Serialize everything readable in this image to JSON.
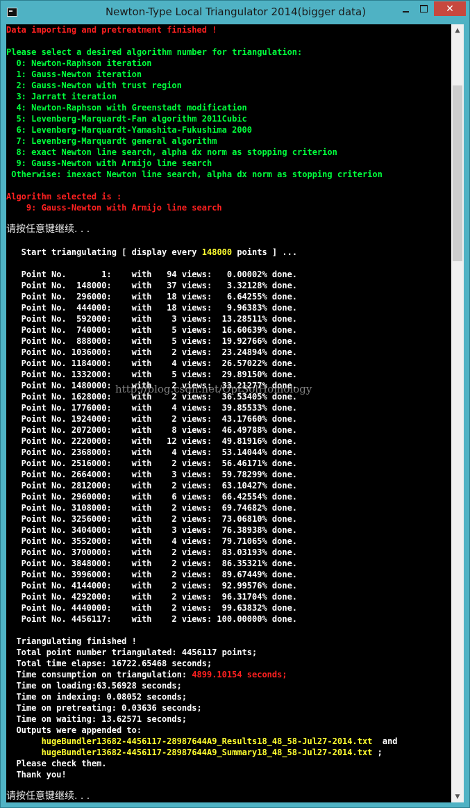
{
  "window": {
    "title": "Newton-Type Local Triangulator 2014(bigger data)",
    "minimize_label": "",
    "close_label": "✕",
    "scroll_up": "▲",
    "scroll_down": "▼"
  },
  "console": {
    "header": "Data importing and pretreatment finished !",
    "prompt": "Please select a desired algorithm number for triangulation:",
    "algorithms": [
      "  0: Newton-Raphson iteration",
      "  1: Gauss-Newton iteration",
      "  2: Gauss-Newton with trust region",
      "  3: Jarratt iteration",
      "  4: Newton-Raphson with Greenstadt modification",
      "  5: Levenberg-Marquardt-Fan algorithm 2011Cubic",
      "  6: Levenberg-Marquardt-Yamashita-Fukushima 2000",
      "  7: Levenberg-Marquardt general algorithm",
      "  8: exact Newton line search, alpha dx norm as stopping criterion",
      "  9: Gauss-Newton with Armijo line search",
      " Otherwise: inexact Newton line search, alpha dx norm as stopping criterion"
    ],
    "selected_label": "Algorithm selected is :",
    "selected_value": "    9: Gauss-Newton with Armijo line search",
    "press_key": "请按任意键继续. . .",
    "start_prefix": "   Start triangulating [ display every ",
    "start_every": "148000",
    "start_suffix": " points ] ...",
    "progress": [
      "   Point No.       1:    with   94 views:   0.00002% done.",
      "   Point No.  148000:    with   37 views:   3.32128% done.",
      "   Point No.  296000:    with   18 views:   6.64255% done.",
      "   Point No.  444000:    with   18 views:   9.96383% done.",
      "   Point No.  592000:    with    3 views:  13.28511% done.",
      "   Point No.  740000:    with    5 views:  16.60639% done.",
      "   Point No.  888000:    with    5 views:  19.92766% done.",
      "   Point No. 1036000:    with    2 views:  23.24894% done.",
      "   Point No. 1184000:    with    4 views:  26.57022% done.",
      "   Point No. 1332000:    with    5 views:  29.89150% done.",
      "   Point No. 1480000:    with    2 views:  33.21277% done.",
      "   Point No. 1628000:    with    2 views:  36.53405% done.",
      "   Point No. 1776000:    with    4 views:  39.85533% done.",
      "   Point No. 1924000:    with    2 views:  43.17660% done.",
      "   Point No. 2072000:    with    8 views:  46.49788% done.",
      "   Point No. 2220000:    with   12 views:  49.81916% done.",
      "   Point No. 2368000:    with    4 views:  53.14044% done.",
      "   Point No. 2516000:    with    2 views:  56.46171% done.",
      "   Point No. 2664000:    with    3 views:  59.78299% done.",
      "   Point No. 2812000:    with    2 views:  63.10427% done.",
      "   Point No. 2960000:    with    6 views:  66.42554% done.",
      "   Point No. 3108000:    with    2 views:  69.74682% done.",
      "   Point No. 3256000:    with    2 views:  73.06810% done.",
      "   Point No. 3404000:    with    3 views:  76.38938% done.",
      "   Point No. 3552000:    with    4 views:  79.71065% done.",
      "   Point No. 3700000:    with    2 views:  83.03193% done.",
      "   Point No. 3848000:    with    2 views:  86.35321% done.",
      "   Point No. 3996000:    with    2 views:  89.67449% done.",
      "   Point No. 4144000:    with    2 views:  92.99576% done.",
      "   Point No. 4292000:    with    2 views:  96.31704% done.",
      "   Point No. 4440000:    with    2 views:  99.63832% done.",
      "   Point No. 4456117:    with    2 views: 100.00000% done."
    ],
    "summary": {
      "finished": "  Triangulating finished !",
      "total_points": "  Total point number triangulated: 4456117 points;",
      "total_time": "  Total time elapse: 16722.65468 seconds;",
      "consumption_label": "  Time consumption on triangulation: ",
      "consumption_value": "4899.10154 seconds;",
      "loading": "  Time on loading:63.56928 seconds;",
      "indexing": "  Time on indexing: 0.08052 seconds;",
      "pretreating": "  Time on pretreating: 0.03636 seconds;",
      "waiting": "  Time on waiting: 13.62571 seconds;",
      "outputs": "  Outputs were appended to:",
      "file1_indent": "       ",
      "file1": "hugeBundler13682-4456117-28987644A9_Results18_48_58-Jul27-2014.txt",
      "file1_suffix": "  and",
      "file2_indent": "       ",
      "file2": "hugeBundler13682-4456117-28987644A9_Summary18_48_58-Jul27-2014.txt",
      "file2_suffix": " ;",
      "check": "  Please check them.",
      "thanks": "  Thank you!"
    },
    "press_key_end": "请按任意键继续. . ."
  },
  "watermark": "http://blog.csdn.net/OptSolHomology",
  "colors": {
    "green": "#00ff3c",
    "red": "#ff2020",
    "yellow": "#ffff30",
    "white": "#ffffff",
    "background": "#000000",
    "frame": "#4fb2c4"
  }
}
